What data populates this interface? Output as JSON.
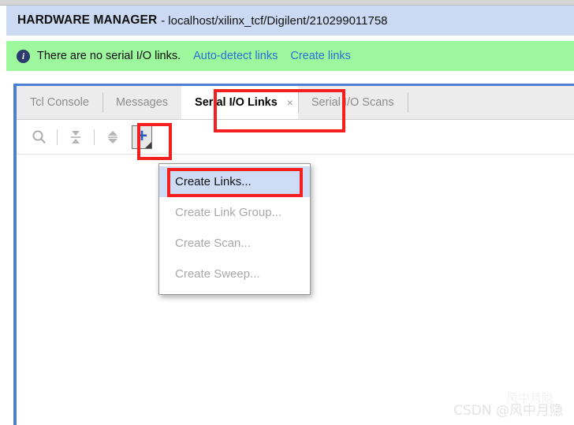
{
  "header": {
    "title": "HARDWARE MANAGER",
    "separator": "-",
    "path": "localhost/xilinx_tcf/Digilent/210299011758"
  },
  "info_bar": {
    "icon": "info-icon",
    "message": "There are no serial I/O links.",
    "links": [
      {
        "label": "Auto-detect links"
      },
      {
        "label": "Create links"
      }
    ],
    "background_color": "#9df79d",
    "link_color": "#2a6fd6"
  },
  "tabs": [
    {
      "label": "Tcl Console",
      "active": false
    },
    {
      "label": "Messages",
      "active": false
    },
    {
      "label": "Serial I/O Links",
      "active": true,
      "close": "×"
    },
    {
      "label": "Serial I/O Scans",
      "active": false
    }
  ],
  "toolbar": {
    "buttons": [
      {
        "name": "search-icon",
        "tooltip": "Search"
      },
      {
        "name": "collapse-all-icon",
        "tooltip": "Collapse All"
      },
      {
        "name": "expand-collapse-icon",
        "tooltip": "Expand/Collapse"
      },
      {
        "name": "add-button",
        "glyph": "+",
        "tooltip": "Create Links"
      }
    ]
  },
  "context_menu": {
    "items": [
      {
        "label": "Create Links...",
        "enabled": true
      },
      {
        "label": "Create Link Group...",
        "enabled": false
      },
      {
        "label": "Create Scan...",
        "enabled": false
      },
      {
        "label": "Create Sweep...",
        "enabled": false
      }
    ],
    "highlight_color": "#cfdcf5"
  },
  "annotations": {
    "color": "#f42020",
    "boxes": [
      {
        "name": "annotation-serial-io-links-tab"
      },
      {
        "name": "annotation-add-button"
      },
      {
        "name": "annotation-create-links-item"
      }
    ]
  },
  "watermark": {
    "text": "CSDN @风中月隐",
    "ghost": "风中月隐"
  },
  "colors": {
    "header_bg": "#ccd9f2",
    "panel_border": "#4a7fd4",
    "tab_bar_bg": "#ececec",
    "plus": "#2a5bbd"
  }
}
